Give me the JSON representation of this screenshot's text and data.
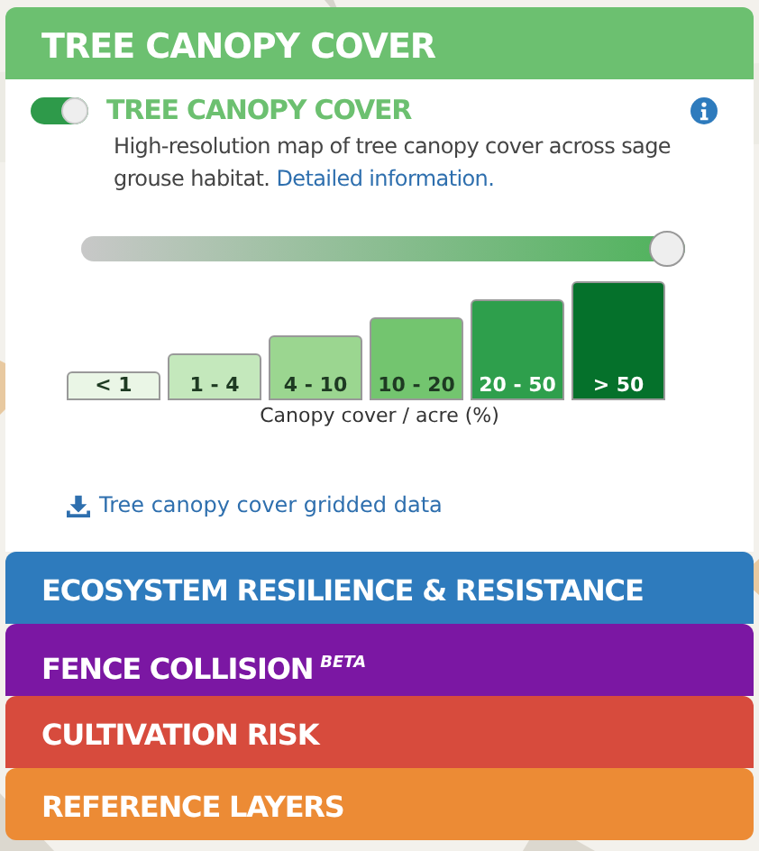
{
  "panel": {
    "title": "TREE CANOPY COVER",
    "layer": {
      "title": "TREE CANOPY COVER",
      "on": true,
      "description": "High-resolution map of tree canopy cover across sage grouse habitat.",
      "link": "Detailed information.",
      "opacity": {
        "level": 1.0
      },
      "legend": [
        {
          "label": "< 1",
          "color": "#eaf6e6"
        },
        {
          "label": "1 - 4",
          "color": "#c4e8bc"
        },
        {
          "label": "4 - 10",
          "color": "#9bd690"
        },
        {
          "label": "10 - 20",
          "color": "#73c56f"
        },
        {
          "label": "20 - 50",
          "color": "#2e9f4c"
        },
        {
          "label": "> 50",
          "color": "#05712b"
        }
      ],
      "legend_caption": "Canopy cover / acre (%)",
      "download": "Tree canopy cover gridded data"
    }
  },
  "sections": [
    {
      "title": "ECOSYSTEM RESILIENCE & RESISTANCE",
      "color": "#2e7bbd"
    },
    {
      "title": "FENCE COLLISION",
      "badge": "BETA",
      "color": "#7b17a3"
    },
    {
      "title": "CULTIVATION RISK",
      "color": "#d74b3d"
    },
    {
      "title": "REFERENCE LAYERS",
      "color": "#ec8b35"
    }
  ]
}
